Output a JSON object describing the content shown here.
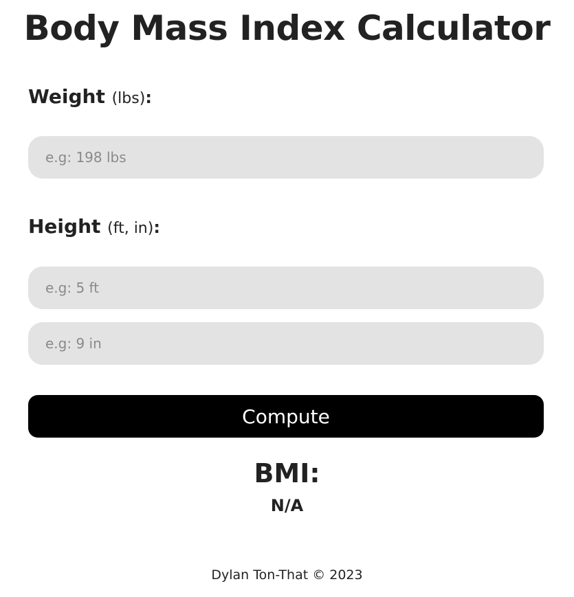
{
  "page": {
    "title": "Body Mass Index Calculator"
  },
  "weight": {
    "label": "Weight",
    "unit": "(lbs)",
    "colon": ":",
    "input": {
      "value": "",
      "placeholder": "e.g: 198 lbs"
    }
  },
  "height": {
    "label": "Height",
    "unit": "(ft, in)",
    "colon": ":",
    "feet_input": {
      "value": "",
      "placeholder": "e.g: 5 ft"
    },
    "inches_input": {
      "value": "",
      "placeholder": "e.g: 9 in"
    }
  },
  "actions": {
    "compute_label": "Compute"
  },
  "result": {
    "heading": "BMI:",
    "value": "N/A"
  },
  "footer": {
    "text": "Dylan Ton-That © 2023"
  },
  "colors": {
    "background": "#ffffff",
    "text": "#222222",
    "input_background": "#e3e3e3",
    "placeholder": "#8a8a8a",
    "button_background": "#000000",
    "button_text": "#ffffff"
  }
}
